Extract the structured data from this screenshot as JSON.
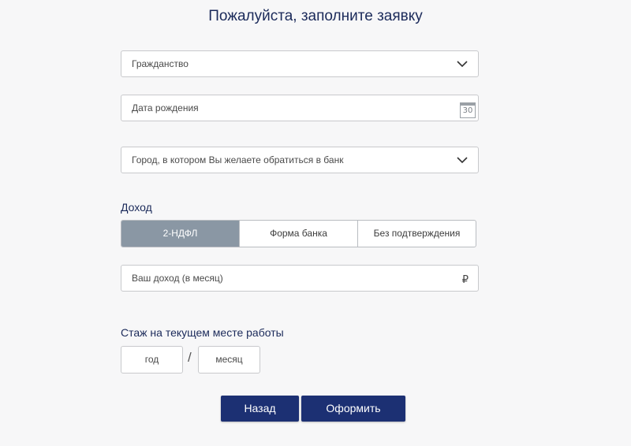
{
  "page": {
    "title": "Пожалуйста, заполните заявку"
  },
  "form": {
    "citizenship": {
      "placeholder": "Гражданство",
      "icon": "chevron-down-icon"
    },
    "birth_date": {
      "placeholder": "Дата рождения",
      "icon": "calendar-icon",
      "icon_text": "30"
    },
    "city": {
      "placeholder": "Город, в котором Вы желаете обратиться в банк",
      "icon": "chevron-down-icon"
    },
    "income_label": "Доход",
    "income_options": [
      {
        "label": "2-НДФЛ",
        "selected": true
      },
      {
        "label": "Форма банка",
        "selected": false
      },
      {
        "label": "Без подтверждения",
        "selected": false
      }
    ],
    "monthly_income": {
      "placeholder": "Ваш доход (в месяц)",
      "currency_symbol": "₽"
    },
    "experience_label": "Стаж на текущем месте работы",
    "experience_years": {
      "placeholder": "год"
    },
    "experience_separator": "/",
    "experience_months": {
      "placeholder": "месяц"
    }
  },
  "buttons": {
    "back": "Назад",
    "submit": "Оформить"
  },
  "colors": {
    "primary_button": "#1c3073",
    "selected_option": "#8a97a4",
    "heading": "#1b2a5a",
    "background": "#f7f7f8"
  }
}
